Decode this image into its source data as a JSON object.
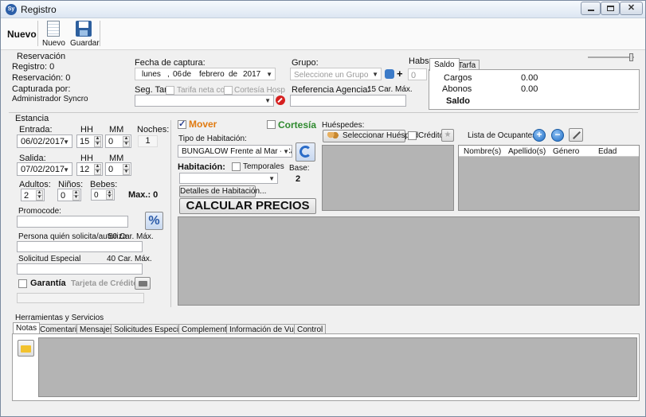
{
  "window": {
    "title": "Registro",
    "app_icon": "app-logo-icon"
  },
  "toolbar": {
    "section_label": "Nuevo",
    "new_label": "Nuevo",
    "save_label": "Guardar"
  },
  "reservacion": {
    "legend": "Reservación",
    "registro": "Registro:  0",
    "reservacion": "Reservación:  0",
    "capturada_label": "Capturada por:",
    "capturada_value": "Administrador Syncro",
    "fecha_label": "Fecha de captura:",
    "fecha_day": "lunes",
    "fecha_sep1": ",",
    "fecha_num": "06",
    "fecha_de1": "de",
    "fecha_month": "febrero",
    "fecha_de2": "de",
    "fecha_year": "2017",
    "seg_tar_label": "Seg. Tar.",
    "tarifa_neta": "Tarifa neta conf.",
    "cortesia_hosp": "Cortesía Hosp",
    "grupo_label": "Grupo:",
    "grupo_placeholder": "Seleccione un Grupo",
    "habs_label": "Habs.",
    "habs_value": "0",
    "ref_label": "Referencia Agencia:",
    "ref_max": "15 Car. Máx."
  },
  "saldo": {
    "tab_saldo": "Saldo",
    "tab_tarifa": "Tarfa",
    "cargos_label": "Cargos",
    "cargos_value": "0.00",
    "abonos_label": "Abonos",
    "abonos_value": "0.00",
    "saldo_label": "Saldo"
  },
  "estancia": {
    "legend": "Estancia",
    "entrada_label": "Entrada:",
    "entrada_value": "06/02/2017",
    "hh_label": "HH",
    "mm_label": "MM",
    "entrada_hh": "15",
    "entrada_mm": "0",
    "noches_label": "Noches:",
    "noches_value": "1",
    "salida_label": "Salida:",
    "salida_value": "07/02/2017",
    "salida_hh": "12",
    "salida_mm": "0",
    "adultos_label": "Adultos:",
    "adultos_value": "2",
    "ninos_label": "Niños:",
    "ninos_value": "0",
    "bebes_label": "Bebes:",
    "bebes_value": "0",
    "max_label": "Max.: 0",
    "promocode_label": "Promocode:",
    "persona_label": "Persona quién solicita/autoriza",
    "persona_max": "50 Car. Máx.",
    "solicitud_label": "Solicitud Especial",
    "solicitud_max": "40 Car. Máx.",
    "garantia_label": "Garantía",
    "tarjeta_label": "Tarjeta de Crédito:"
  },
  "habitacion": {
    "mover_label": "Mover",
    "cortesia_label": "Cortesía",
    "tipo_label": "Tipo de Habitación:",
    "tipo_value": "BUNGALOW Frente al Mar - Cama I",
    "habitacion_label": "Habitación:",
    "temporales_label": "Temporales",
    "base_label": "Base:",
    "base_value": "2",
    "detalles_button": "Detalles de Habitación...",
    "calcular_button": "CALCULAR PRECIOS"
  },
  "huespedes": {
    "label": "Huéspedes:",
    "select_button": "Seleccionar Huésped",
    "credito_label": "Crédito",
    "ocupantes_label": "Lista de Ocupantes",
    "columns": [
      "Nombre(s)",
      "Apellido(s)",
      "Género",
      "Edad"
    ]
  },
  "herramientas": {
    "legend": "Herramientas y Servicios",
    "tabs": [
      "Notas",
      "Comentarios",
      "Mensajes",
      "Solicitudes Especiales",
      "Complementos",
      "Información de Vuelos",
      "Control"
    ]
  },
  "colors": {
    "mover": "#e07a10",
    "cortesia": "#2f8a2f",
    "calcular_text": "#1a1a1a",
    "panel_gray": "#b4b4b4"
  }
}
